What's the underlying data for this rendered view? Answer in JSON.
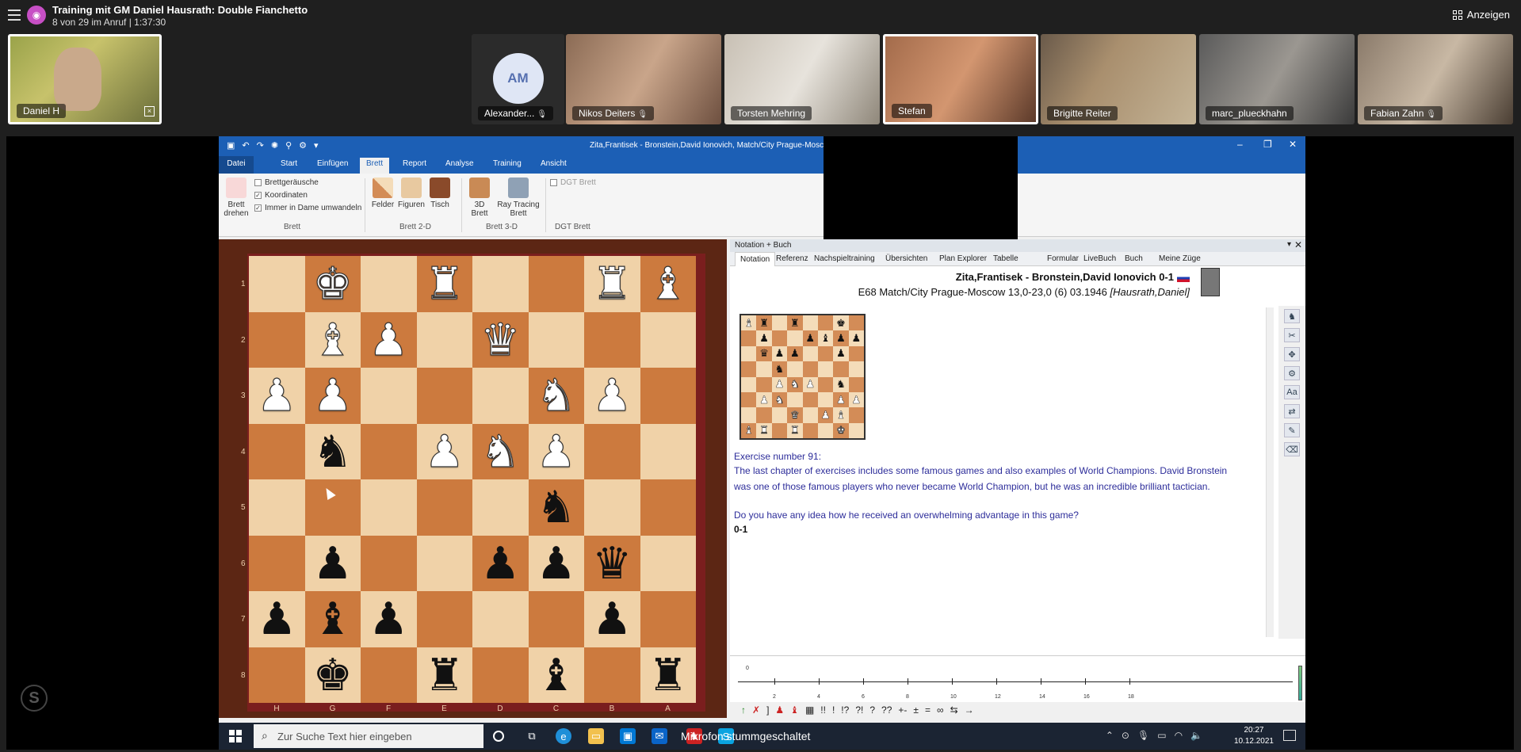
{
  "meeting": {
    "title": "Training mit GM Daniel Hausrath: Double Fianchetto",
    "subtitle": "8 von 29 im Anruf | 1:37:30",
    "show_label": "Anzeigen"
  },
  "participants": {
    "self": "Daniel H",
    "others": [
      {
        "name": "Alexander...",
        "initials": "AM"
      },
      {
        "name": "Nikos Deiters"
      },
      {
        "name": "Torsten Mehring"
      },
      {
        "name": "Stefan"
      },
      {
        "name": "Brigitte Reiter"
      },
      {
        "name": "marc_plueckhahn"
      },
      {
        "name": "Fabian Zahn"
      }
    ]
  },
  "chessbase": {
    "window_title": "Zita,Frantisek - Bronstein,David Ionovich, Match/City Prague-Mosco",
    "file_tab": "Datei",
    "tabs": [
      "Start",
      "Einfügen",
      "Brett",
      "Report",
      "Analyse",
      "Training",
      "Ansicht"
    ],
    "selected_tab": "Brett",
    "ribbon": {
      "rotate_label": "Brett drehen",
      "checks": [
        {
          "label": "Brettgeräusche",
          "checked": false
        },
        {
          "label": "Koordinaten",
          "checked": true
        },
        {
          "label": "Immer in Dame umwandeln",
          "checked": true
        }
      ],
      "group_brett": "Brett",
      "felder": "Felder",
      "figuren": "Figuren",
      "tisch": "Tisch",
      "group_2d": "Brett 2-D",
      "btn_3d": "3D Brett",
      "ray": "Ray Tracing Brett",
      "group_3d": "Brett 3-D",
      "dgt_check": "DGT Brett",
      "group_dgt": "DGT Brett"
    }
  },
  "board": {
    "ranks": [
      "1",
      "2",
      "3",
      "4",
      "5",
      "6",
      "7",
      "8"
    ],
    "files": [
      "H",
      "G",
      "F",
      "E",
      "D",
      "C",
      "B",
      "A"
    ]
  },
  "notation": {
    "panel_title": "Notation + Buch",
    "tabs": [
      "Notation",
      "Referenz",
      "Nachspieltraining",
      "Übersichten",
      "Plan Explorer",
      "Tabelle",
      "Formular",
      "LiveBuch",
      "Buch",
      "Meine Züge"
    ],
    "header_players": "Zita,Frantisek - Bronstein,David Ionovich  0-1",
    "header_event": "E68 Match/City Prague-Moscow 13,0-23,0 (6) 03.1946",
    "header_annotator": "[Hausrath,Daniel]",
    "exercise_title": "Exercise number 91:",
    "exercise_text": "The last chapter of exercises includes some famous games and also examples of World Champions. David Bronstein was one of those famous players who never became World Champion, but he was an incredible brilliant tactician.",
    "exercise_question": "Do you have any idea how he received an overwhelming advantage in this game?",
    "result": "0-1",
    "timeline_zero": "0",
    "timeline_ticks": [
      "2",
      "4",
      "6",
      "8",
      "10",
      "12",
      "14",
      "16",
      "18"
    ],
    "annotation_symbols": [
      "!!",
      "!",
      "!?",
      "?!",
      "?",
      "??",
      "+-",
      "±",
      "=",
      "∞",
      "⇆",
      "→"
    ]
  },
  "taskbar": {
    "search_placeholder": "Zur Suche Text hier eingeben",
    "mic_message": "Mikrofon stummgeschaltet",
    "time": "20:27",
    "date": "10.12.2021"
  }
}
